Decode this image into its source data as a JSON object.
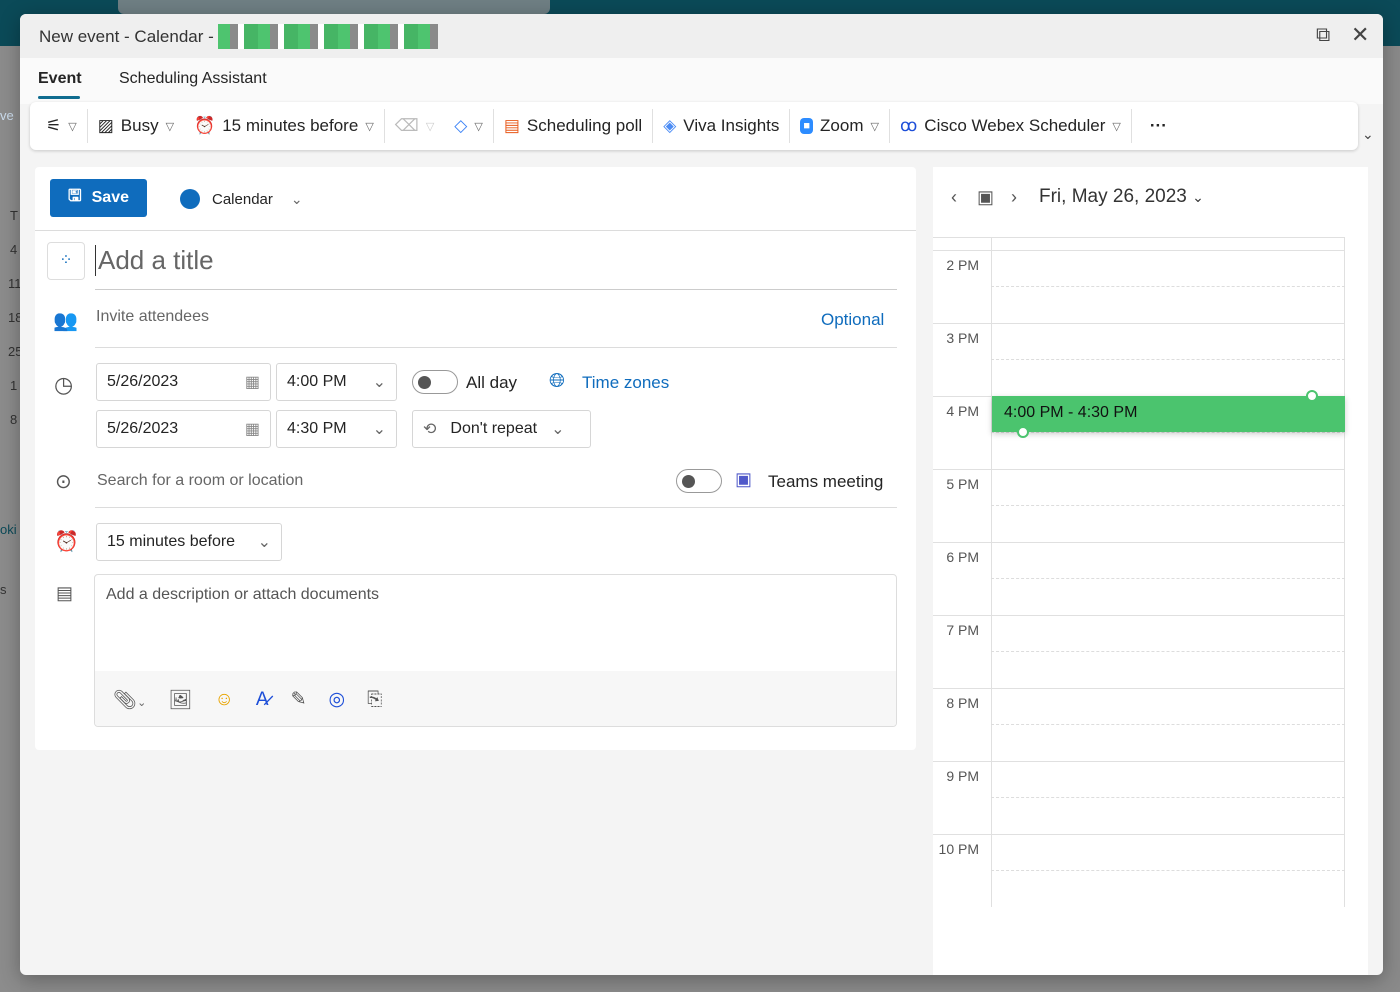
{
  "window": {
    "title": "New event - Calendar -",
    "popout_icon": "popout-icon",
    "close_icon": "close-icon"
  },
  "background": {
    "left_text": [
      "ve",
      "T",
      "4",
      "11",
      "18",
      "25",
      "1",
      "8",
      "oki",
      "s"
    ]
  },
  "tabs": [
    {
      "label": "Event",
      "active": true
    },
    {
      "label": "Scheduling Assistant"
    }
  ],
  "toolbar": {
    "busy": "Busy",
    "reminder": "15 minutes before",
    "poll": "Scheduling poll",
    "viva": "Viva Insights",
    "zoom": "Zoom",
    "webex": "Cisco Webex Scheduler",
    "more": "···"
  },
  "form": {
    "save": "Save",
    "calendar": "Calendar",
    "calendar_color": "#0f6cbd",
    "title_placeholder": "Add a title",
    "attendees_placeholder": "Invite attendees",
    "optional": "Optional",
    "start_date": "5/26/2023",
    "start_time": "4:00 PM",
    "end_date": "5/26/2023",
    "end_time": "4:30 PM",
    "all_day": "All day",
    "all_day_on": false,
    "time_zones": "Time zones",
    "repeat": "Don't repeat",
    "location_placeholder": "Search for a room or location",
    "teams": "Teams meeting",
    "teams_on": false,
    "reminder": "15 minutes before",
    "description_placeholder": "Add a description or attach documents"
  },
  "calendar": {
    "date": "Fri, May 26, 2023",
    "hours": [
      "2 PM",
      "3 PM",
      "4 PM",
      "5 PM",
      "6 PM",
      "7 PM",
      "8 PM",
      "9 PM",
      "10 PM"
    ],
    "event": "4:00 PM - 4:30 PM",
    "event_color": "#4bc46e"
  }
}
